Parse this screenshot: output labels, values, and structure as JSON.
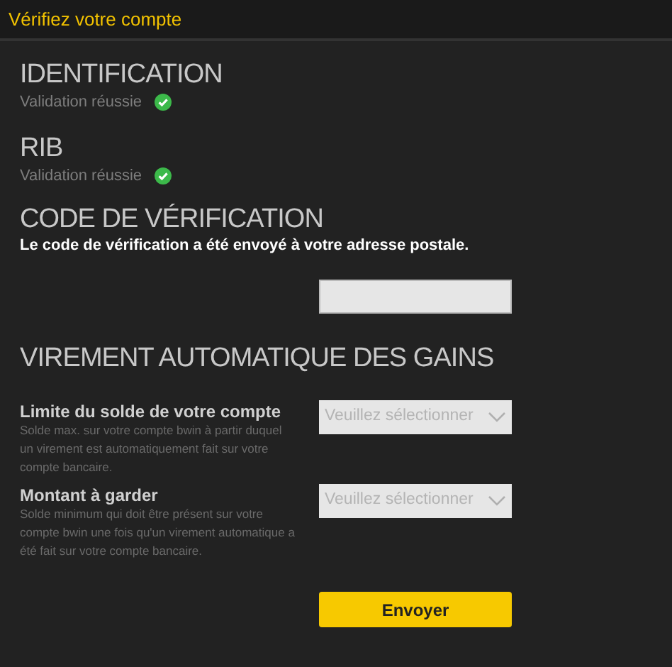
{
  "header": {
    "title": "Vérifiez votre compte"
  },
  "sections": [
    {
      "title": "IDENTIFICATION",
      "status": "Validation réussie",
      "validated": true
    },
    {
      "title": "RIB",
      "status": "Validation réussie",
      "validated": true
    }
  ],
  "verification": {
    "title": "CODE DE VÉRIFICATION",
    "message": "Le code de vérification a été envoyé à votre adresse postale."
  },
  "transfer": {
    "title": "VIREMENT AUTOMATIQUE DES GAINS",
    "fields": [
      {
        "label": "Limite du solde de votre compte",
        "description": "Solde max. sur votre compte bwin à partir duquel un virement est automatiquement fait sur votre compte bancaire.",
        "placeholder": "Veuillez sélectionner"
      },
      {
        "label": "Montant à garder",
        "description": "Solde minimum qui doit être présent sur votre compte bwin une fois qu'un virement automatique a été fait sur votre compte bancaire.",
        "placeholder": "Veuillez sélectionner"
      }
    ],
    "submit": "Envoyer"
  }
}
